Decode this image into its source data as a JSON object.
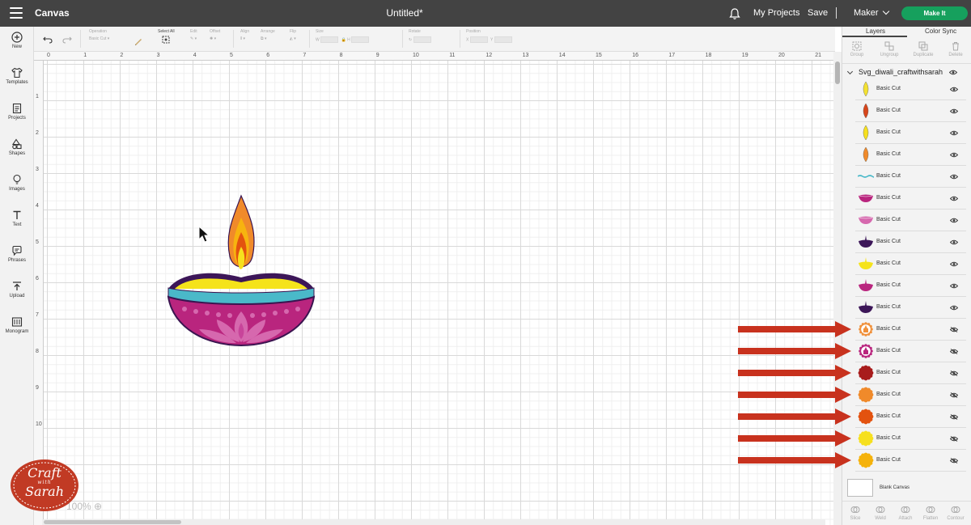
{
  "topbar": {
    "app_title": "Canvas",
    "doc_title": "Untitled*",
    "my_projects": "My Projects",
    "save": "Save",
    "separator": "|",
    "machine": "Maker",
    "make_it": "Make It"
  },
  "left_sidebar": {
    "items": [
      {
        "label": "New",
        "icon": "plus-circle-icon"
      },
      {
        "label": "Templates",
        "icon": "shirt-icon"
      },
      {
        "label": "Projects",
        "icon": "projects-icon"
      },
      {
        "label": "Shapes",
        "icon": "shapes-icon"
      },
      {
        "label": "Images",
        "icon": "bulb-icon"
      },
      {
        "label": "Text",
        "icon": "text-icon"
      },
      {
        "label": "Phrases",
        "icon": "speech-bubble-icon"
      },
      {
        "label": "Upload",
        "icon": "upload-icon"
      },
      {
        "label": "Monogram",
        "icon": "monogram-icon"
      }
    ]
  },
  "edit_toolbar": {
    "operation_label": "Operation",
    "operation_value": "Basic Cut",
    "select_all": "Select All",
    "edit": "Edit",
    "offset": "Offset",
    "align": "Align",
    "arrange": "Arrange",
    "flip": "Flip",
    "size": "Size",
    "rotate": "Rotate",
    "position": "Position"
  },
  "rulers": {
    "top": [
      "0",
      "1",
      "2",
      "3",
      "4",
      "5",
      "6",
      "7",
      "8",
      "9",
      "10",
      "11",
      "12",
      "13",
      "14",
      "15",
      "16",
      "17",
      "18",
      "19",
      "20",
      "21"
    ],
    "left": [
      "1",
      "2",
      "3",
      "4",
      "5",
      "6",
      "7",
      "8",
      "9",
      "10"
    ]
  },
  "zoom": "100%",
  "logo": {
    "line1": "Craft",
    "line2": "with",
    "line3": "Sarah"
  },
  "layers_panel": {
    "tabs": [
      "Layers",
      "Color Sync"
    ],
    "actions": [
      "Group",
      "Ungroup",
      "Duplicate",
      "Delete"
    ],
    "group_name": "Svg_diwali_craftwithsarah",
    "layers": [
      {
        "name": "Basic Cut",
        "color": "#f3e131",
        "shape": "leaf",
        "visible": true
      },
      {
        "name": "Basic Cut",
        "color": "#d7461b",
        "shape": "leaf",
        "visible": true
      },
      {
        "name": "Basic Cut",
        "color": "#f6e01e",
        "shape": "leaf",
        "visible": true
      },
      {
        "name": "Basic Cut",
        "color": "#f08a2a",
        "shape": "leaf",
        "visible": true
      },
      {
        "name": "Basic Cut",
        "color": "#4ab9c9",
        "shape": "wave",
        "visible": true
      },
      {
        "name": "Basic Cut",
        "color": "#b9257e",
        "shape": "bowl-rim",
        "visible": true
      },
      {
        "name": "Basic Cut",
        "color": "#d668ae",
        "shape": "bowl-rim",
        "visible": true
      },
      {
        "name": "Basic Cut",
        "color": "#3c1658",
        "shape": "bowl",
        "visible": true
      },
      {
        "name": "Basic Cut",
        "color": "#f5e31a",
        "shape": "bowl",
        "visible": true
      },
      {
        "name": "Basic Cut",
        "color": "#b9257e",
        "shape": "bowl",
        "visible": true
      },
      {
        "name": "Basic Cut",
        "color": "#3c1658",
        "shape": "bowl",
        "visible": true
      },
      {
        "name": "Basic Cut",
        "color": "#f0903a",
        "shape": "flower-outline",
        "visible": false
      },
      {
        "name": "Basic Cut",
        "color": "#b9257e",
        "shape": "flower-outline",
        "visible": false
      },
      {
        "name": "Basic Cut",
        "color": "#a81c1c",
        "shape": "flower",
        "visible": false
      },
      {
        "name": "Basic Cut",
        "color": "#f08a2a",
        "shape": "flower",
        "visible": false
      },
      {
        "name": "Basic Cut",
        "color": "#e3520f",
        "shape": "flower",
        "visible": false
      },
      {
        "name": "Basic Cut",
        "color": "#f6e01e",
        "shape": "flower",
        "visible": false
      },
      {
        "name": "Basic Cut",
        "color": "#f5b20a",
        "shape": "flower",
        "visible": false
      }
    ],
    "blank_canvas": "Blank Canvas",
    "bottom_actions": [
      "Slice",
      "Weld",
      "Attach",
      "Flatten",
      "Contour"
    ]
  },
  "colors": {
    "topbar": "#434343",
    "make_it": "#16a05d",
    "arrow": "#c8321e"
  }
}
